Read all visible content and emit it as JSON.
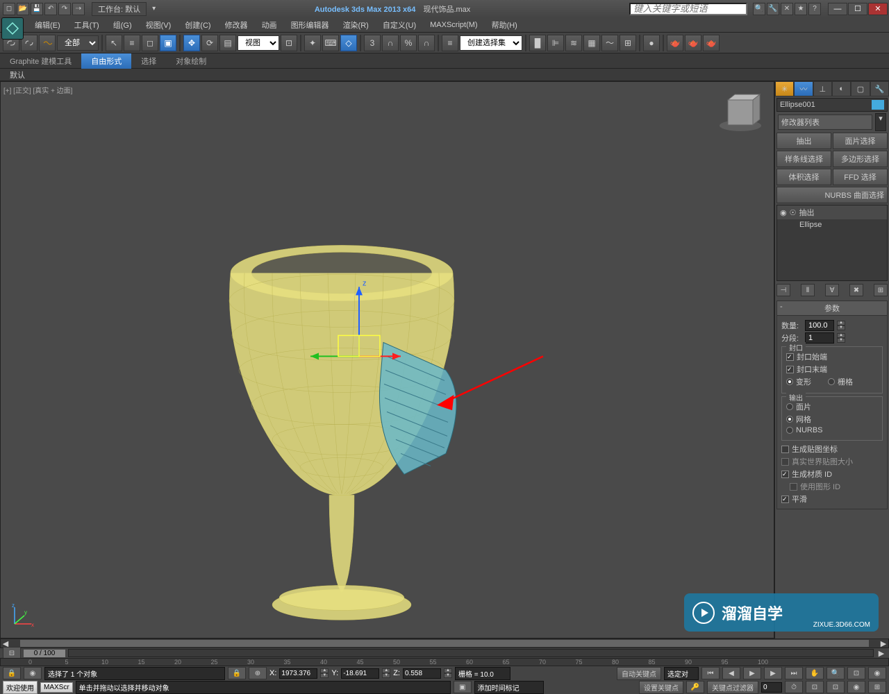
{
  "titlebar": {
    "workspace_label": "工作台: 默认",
    "app_name": "Autodesk 3ds Max  2013 x64",
    "file_name": "现代饰品.max",
    "search_placeholder": "键入关键字或短语"
  },
  "menubar": [
    "编辑(E)",
    "工具(T)",
    "组(G)",
    "视图(V)",
    "创建(C)",
    "修改器",
    "动画",
    "图形编辑器",
    "渲染(R)",
    "自定义(U)",
    "MAXScript(M)",
    "帮助(H)"
  ],
  "toolbar": {
    "selection_filter": "全部",
    "view_dropdown": "视图",
    "named_sets": "创建选择集"
  },
  "ribbon": {
    "tabs": [
      "Graphite 建模工具",
      "自由形式",
      "选择",
      "对象绘制"
    ],
    "active_tab": 1,
    "sub_label": "默认"
  },
  "viewport": {
    "label": "[+] [正交] [真实 + 边面]"
  },
  "cmd_panel": {
    "object_name": "Ellipse001",
    "modifier_dropdown": "修改器列表",
    "quick_buttons": [
      "抽出",
      "面片选择",
      "样条线选择",
      "多边形选择",
      "体积选择",
      "FFD 选择"
    ],
    "nurbs_btn": "NURBS 曲面选择",
    "stack": [
      {
        "icon": "◉",
        "label": "抽出",
        "selected": true
      },
      {
        "icon": "",
        "label": "Ellipse",
        "selected": false
      }
    ]
  },
  "rollout_params": {
    "title": "参数",
    "amount_label": "数量:",
    "amount_value": "100.0",
    "segments_label": "分段:",
    "segments_value": "1",
    "capping_title": "封口",
    "cap_start": "封口始端",
    "cap_end": "封口末端",
    "morph": "变形",
    "grid": "栅格",
    "output_title": "输出",
    "patch": "面片",
    "mesh": "网格",
    "nurbs": "NURBS",
    "gen_map": "生成贴图坐标",
    "real_world": "真实世界贴图大小",
    "gen_matid": "生成材质 ID",
    "use_shapeid": "使用图形 ID",
    "smooth": "平滑"
  },
  "timeline": {
    "slider_label": "0 / 100",
    "ticks": [
      0,
      5,
      10,
      15,
      20,
      25,
      30,
      35,
      40,
      45,
      50,
      55,
      60,
      65,
      70,
      75,
      80,
      85,
      90,
      95,
      100
    ]
  },
  "status": {
    "selection_text": "选择了 1 个对象",
    "x": "1973.376",
    "y": "-18.691",
    "z": "0.558",
    "grid": "栅格 = 10.0",
    "autokey": "自动关键点",
    "selected_set": "选定对",
    "welcome": "欢迎使用",
    "maxscr": "MAXScr",
    "hint": "单击并拖动以选择并移动对象",
    "add_marker": "添加时间标记",
    "set_key": "设置关键点",
    "key_filters": "关键点过滤器"
  },
  "watermark": {
    "text": "溜溜自学",
    "url": "ZIXUE.3D66.COM"
  }
}
